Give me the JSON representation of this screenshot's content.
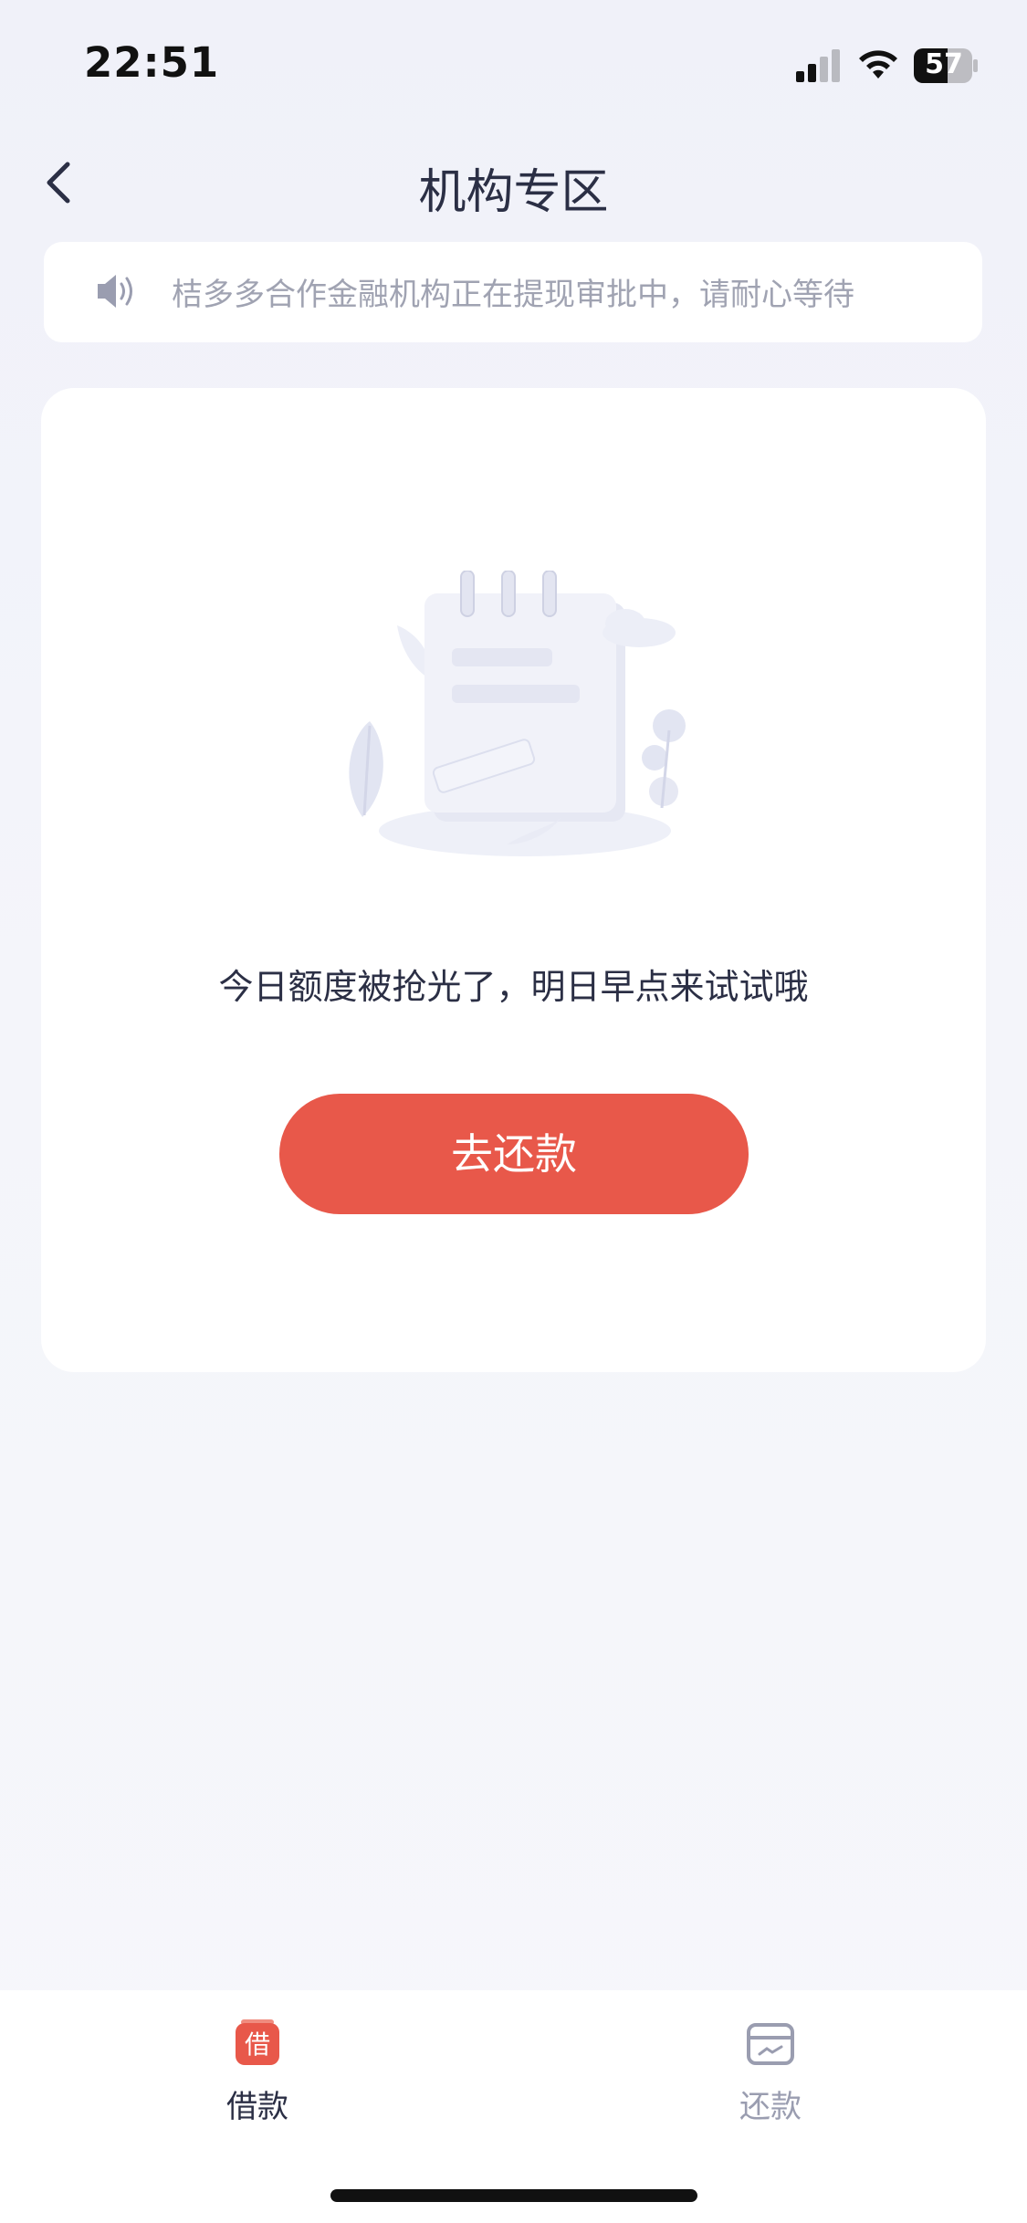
{
  "status_bar": {
    "time": "22:51",
    "battery": "57"
  },
  "header": {
    "title": "机构专区",
    "back_icon": "chevron-left-icon"
  },
  "notice": {
    "icon": "speaker-icon",
    "text": "桔多多合作金融机构正在提现审批中，请耐心等待"
  },
  "main": {
    "illustration": "empty-notebook-illustration",
    "message": "今日额度被抢光了，明日早点来试试哦",
    "button_label": "去还款",
    "button_color": "#e8584a"
  },
  "tabbar": {
    "tabs": [
      {
        "label": "借款",
        "icon": "borrow-icon",
        "icon_text": "借",
        "active": true
      },
      {
        "label": "还款",
        "icon": "repay-card-icon",
        "active": false
      }
    ]
  },
  "colors": {
    "accent": "#e8584a",
    "text_primary": "#2b2f45",
    "text_secondary": "#a0a3b2",
    "background": "#f4f5fa"
  }
}
